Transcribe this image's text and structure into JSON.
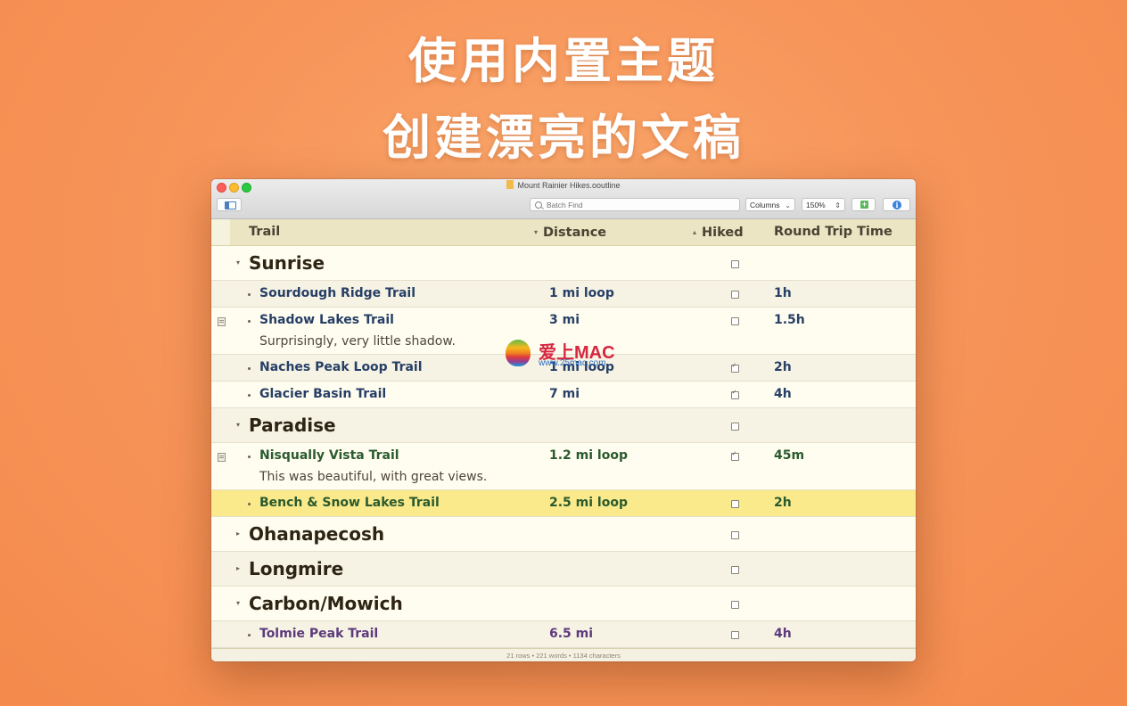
{
  "headline": {
    "line1": "使用内置主题",
    "line2": "创建漂亮的文稿"
  },
  "window": {
    "title": "Mount Rainier Hikes.ooutline"
  },
  "toolbar": {
    "search_placeholder": "Batch Find",
    "columns_label": "Columns",
    "zoom_label": "150%",
    "add_symbol": "+",
    "info_symbol": "i"
  },
  "columns": {
    "trail": "Trail",
    "distance": "Distance",
    "hiked": "Hiked",
    "round_trip": "Round Trip Time"
  },
  "rows": [
    {
      "level": 1,
      "expanded": true,
      "topic": "Sunrise",
      "hiked": false
    },
    {
      "level": 2,
      "topic": "Sourdough Ridge Trail",
      "distance": "1 mi loop",
      "hiked": false,
      "time": "1h",
      "color": "blue"
    },
    {
      "level": 2,
      "topic": "Shadow Lakes Trail",
      "distance": "3 mi",
      "hiked": false,
      "time": "1.5h",
      "note": "Surprisingly, very little shadow.",
      "color": "blue"
    },
    {
      "level": 2,
      "topic": "Naches Peak Loop Trail",
      "distance": "1 mi loop",
      "hiked": true,
      "time": "2h",
      "color": "blue"
    },
    {
      "level": 2,
      "topic": "Glacier Basin Trail",
      "distance": "7 mi",
      "hiked": true,
      "time": "4h",
      "color": "blue"
    },
    {
      "level": 1,
      "expanded": true,
      "topic": "Paradise",
      "hiked": false
    },
    {
      "level": 2,
      "topic": "Nisqually Vista Trail",
      "distance": "1.2 mi loop",
      "hiked": true,
      "time": "45m",
      "note": "This was beautiful, with great views.",
      "color": "green"
    },
    {
      "level": 2,
      "topic": "Bench & Snow Lakes Trail",
      "distance": "2.5 mi loop",
      "hiked": false,
      "time": "2h",
      "color": "green",
      "selected": true
    },
    {
      "level": 1,
      "expanded": false,
      "topic": "Ohanapecosh",
      "hiked": false
    },
    {
      "level": 1,
      "expanded": false,
      "topic": "Longmire",
      "hiked": false
    },
    {
      "level": 1,
      "expanded": true,
      "topic": "Carbon/Mowich",
      "hiked": false
    },
    {
      "level": 2,
      "topic": "Tolmie Peak Trail",
      "distance": "6.5 mi",
      "hiked": false,
      "time": "4h",
      "color": "purple"
    }
  ],
  "status": "21 rows • 221 words • 1134 characters",
  "watermark": {
    "title": "爱上MAC",
    "url": "www.25mac.com"
  }
}
